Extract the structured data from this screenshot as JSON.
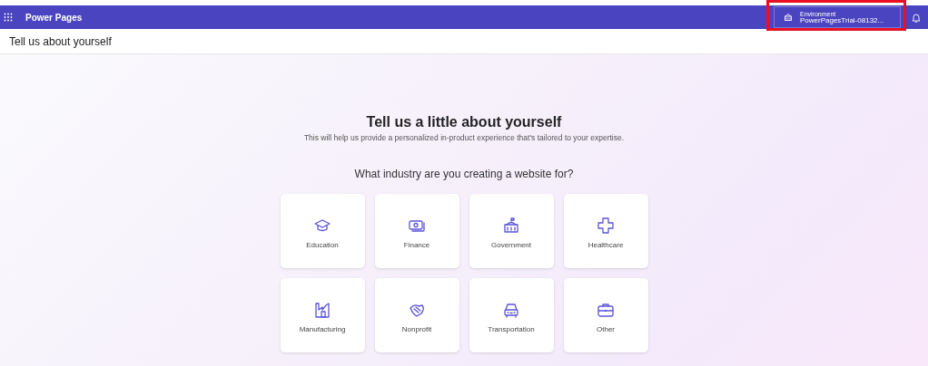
{
  "app_bar": {
    "title": "Power Pages",
    "environment": {
      "label": "Environment",
      "value": "PowerPagesTrial-08132...",
      "highlighted": true
    }
  },
  "page_header": {
    "title": "Tell us about yourself"
  },
  "intro": {
    "heading": "Tell us a little about yourself",
    "subtitle": "This will help us provide a personalized in-product experience that's tailored to your expertise."
  },
  "question": "What industry are you creating a website for?",
  "industries": [
    {
      "label": "Education",
      "selected": false
    },
    {
      "label": "Finance",
      "selected": false
    },
    {
      "label": "Government",
      "selected": false
    },
    {
      "label": "Healthcare",
      "selected": false
    },
    {
      "label": "Manufacturing",
      "selected": false
    },
    {
      "label": "Nonprofit",
      "selected": false
    },
    {
      "label": "Transportation",
      "selected": false
    },
    {
      "label": "Other",
      "selected": false
    }
  ]
}
